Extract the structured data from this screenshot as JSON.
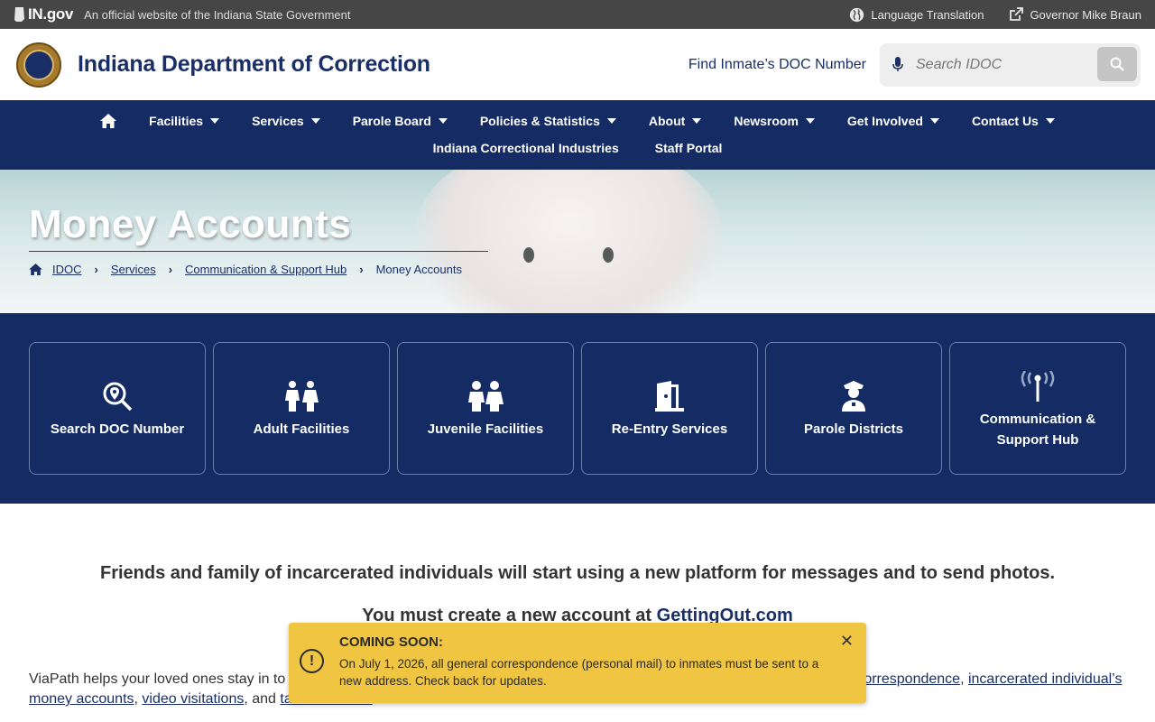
{
  "topbar": {
    "gov_logo": "IN.gov",
    "official_text": "An official website of the Indiana State Government",
    "language": "Language Translation",
    "governor": "Governor Mike Braun"
  },
  "header": {
    "title": "Indiana Department of Correction",
    "find_doc": "Find Inmate’s DOC Number",
    "search_placeholder": "Search IDOC"
  },
  "nav": {
    "row1": [
      "Facilities",
      "Services",
      "Parole Board",
      "Policies & Statistics",
      "About",
      "Newsroom",
      "Get Involved",
      "Contact Us"
    ],
    "row2": [
      "Indiana Correctional Industries",
      "Staff Portal"
    ]
  },
  "hero": {
    "title": "Money Accounts",
    "breadcrumb": [
      "IDOC",
      "Services",
      "Communication & Support Hub",
      "Money Accounts"
    ]
  },
  "cards": [
    {
      "label": "Search DOC Number",
      "icon": "search-location-icon"
    },
    {
      "label": "Adult Facilities",
      "icon": "adults-icon"
    },
    {
      "label": "Juvenile Facilities",
      "icon": "children-icon"
    },
    {
      "label": "Re-Entry Services",
      "icon": "door-open-icon"
    },
    {
      "label": "Parole Districts",
      "icon": "officer-icon"
    },
    {
      "label": "Communication & Support Hub",
      "icon": "broadcast-tower-icon"
    }
  ],
  "content": {
    "lead": "Friends and family of incarcerated individuals will start using a new platform for messages and to send photos.",
    "lead2_prefix": "You must create a new account at ",
    "lead2_link": "GettingOut.com",
    "para_start": "ViaPath helps your loved ones stay in to",
    "para_link1": "correspondence",
    "para_comma": ", ",
    "para_link2": "incarcerated individual’s money accounts",
    "para_link3": "video visitations",
    "para_and": ", and ",
    "para_link4": "tablet services",
    "para_end": "."
  },
  "toast": {
    "title": "COMING SOON:",
    "message": "On July 1, 2026, all general correspondence (personal mail) to inmates must be sent to a new address. Check back for updates."
  },
  "colors": {
    "navy": "#142b63",
    "toast": "#f0c541",
    "topbar": "#464646"
  }
}
